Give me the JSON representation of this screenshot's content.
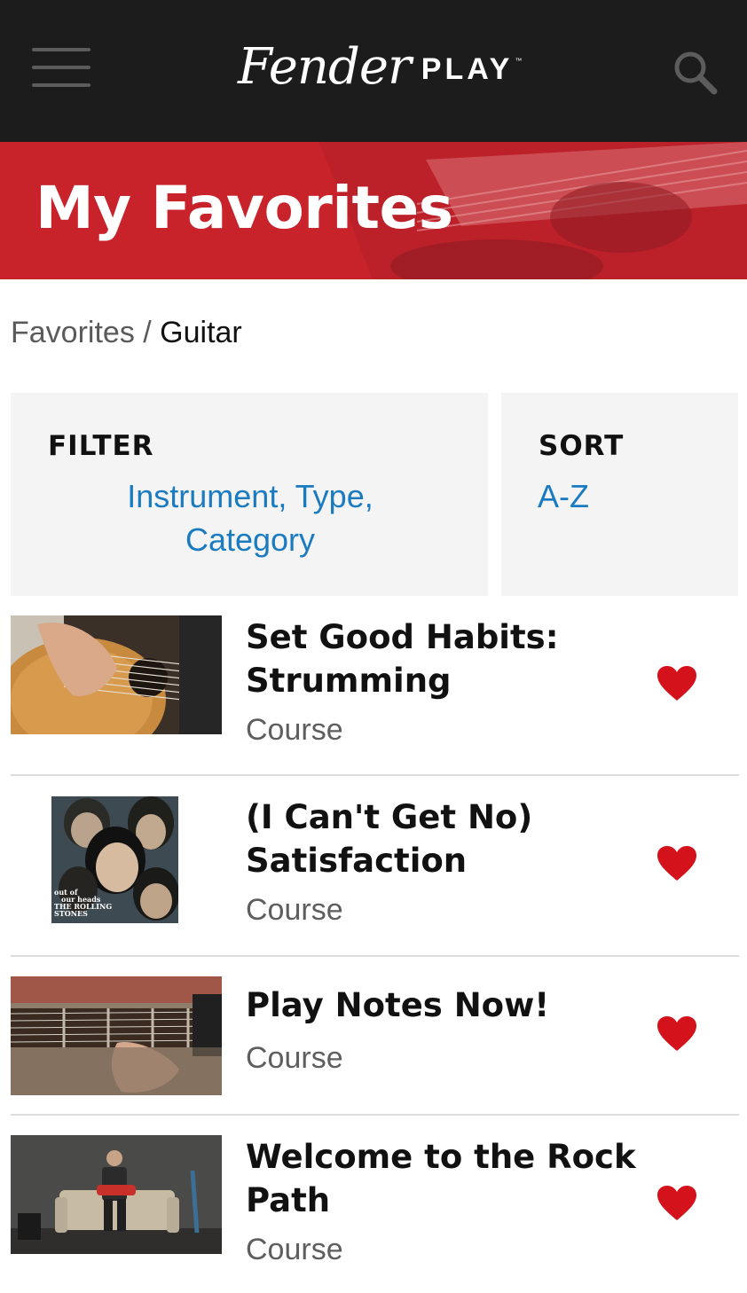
{
  "header": {
    "logo_script": "Fender",
    "logo_play": "PLAY",
    "logo_tm": "™",
    "menu_icon": "hamburger-menu-icon",
    "search_icon": "search-icon"
  },
  "hero": {
    "title": "My Favorites"
  },
  "breadcrumb": {
    "parent": "Favorites",
    "separator": " / ",
    "current": "Guitar"
  },
  "filter": {
    "heading": "FILTER",
    "value": "Instrument, Type, Category"
  },
  "sort": {
    "heading": "SORT",
    "value": "A-Z"
  },
  "items": [
    {
      "title": "Set Good Habits: Strumming",
      "type": "Course",
      "favorited": true,
      "thumbnail": "acoustic-guitar-strumming-thumbnail"
    },
    {
      "title": "(I Can't Get No) Satisfaction",
      "type": "Course",
      "favorited": true,
      "thumbnail": "rolling-stones-album-thumbnail",
      "album_text": [
        "out of",
        "our heads",
        "THE ROLLING",
        "STONES"
      ]
    },
    {
      "title": "Play Notes Now!",
      "type": "Course",
      "favorited": true,
      "thumbnail": "guitar-neck-fretting-thumbnail"
    },
    {
      "title": "Welcome to the Rock Path",
      "type": "Course",
      "favorited": true,
      "thumbnail": "guitarist-on-couch-thumbnail"
    }
  ],
  "colors": {
    "header_bg": "#1c1c1c",
    "hero_red": "#c8222c",
    "link_blue": "#1a7bc0",
    "heart_red": "#d4121c",
    "panel_bg": "#f4f4f4"
  }
}
